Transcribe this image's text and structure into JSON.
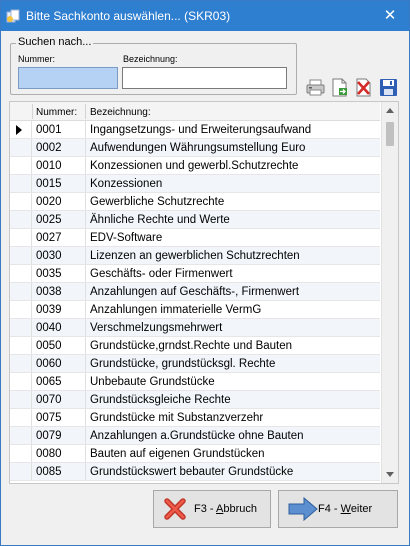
{
  "window": {
    "title": "Bitte Sachkonto auswählen... (SKR03)",
    "close_glyph": "✕"
  },
  "search": {
    "group_label": "Suchen nach...",
    "number_label": "Nummer:",
    "number_value": "",
    "description_label": "Bezeichnung:",
    "description_value": ""
  },
  "toolbar": {
    "icons": [
      "printer-icon",
      "export-sheet-icon",
      "delete-icon",
      "save-disk-icon"
    ]
  },
  "grid": {
    "columns": [
      "Nummer:",
      "Bezeichnung:"
    ],
    "rows": [
      {
        "number": "0001",
        "description": "Ingangsetzungs- und Erweiterungsaufwand"
      },
      {
        "number": "0002",
        "description": "Aufwendungen Währungsumstellung Euro"
      },
      {
        "number": "0010",
        "description": "Konzessionen und gewerbl.Schutzrechte"
      },
      {
        "number": "0015",
        "description": "Konzessionen"
      },
      {
        "number": "0020",
        "description": "Gewerbliche Schutzrechte"
      },
      {
        "number": "0025",
        "description": "Ähnliche Rechte und Werte"
      },
      {
        "number": "0027",
        "description": "EDV-Software"
      },
      {
        "number": "0030",
        "description": "Lizenzen an gewerblichen Schutzrechten"
      },
      {
        "number": "0035",
        "description": "Geschäfts- oder Firmenwert"
      },
      {
        "number": "0038",
        "description": "Anzahlungen auf Geschäfts-, Firmenwert"
      },
      {
        "number": "0039",
        "description": "Anzahlungen immaterielle VermG"
      },
      {
        "number": "0040",
        "description": "Verschmelzungsmehrwert"
      },
      {
        "number": "0050",
        "description": "Grundstücke,grndst.Rechte und Bauten"
      },
      {
        "number": "0060",
        "description": "Grundstücke, grundstücksgl. Rechte"
      },
      {
        "number": "0065",
        "description": "Unbebaute Grundstücke"
      },
      {
        "number": "0070",
        "description": "Grundstücksgleiche Rechte"
      },
      {
        "number": "0075",
        "description": "Grundstücke mit Substanzverzehr"
      },
      {
        "number": "0079",
        "description": "Anzahlungen a.Grundstücke ohne Bauten"
      },
      {
        "number": "0080",
        "description": "Bauten auf eigenen Grundstücken"
      },
      {
        "number": "0085",
        "description": "Grundstückswert bebauter Grundstücke"
      }
    ]
  },
  "buttons": {
    "cancel_label": "F3 - Abbruch",
    "next_label": "F4 - Weiter"
  },
  "colors": {
    "titlebar": "#2f7fd1",
    "active_field": "#b5d2f5",
    "alt_row": "#f2f6fb"
  }
}
